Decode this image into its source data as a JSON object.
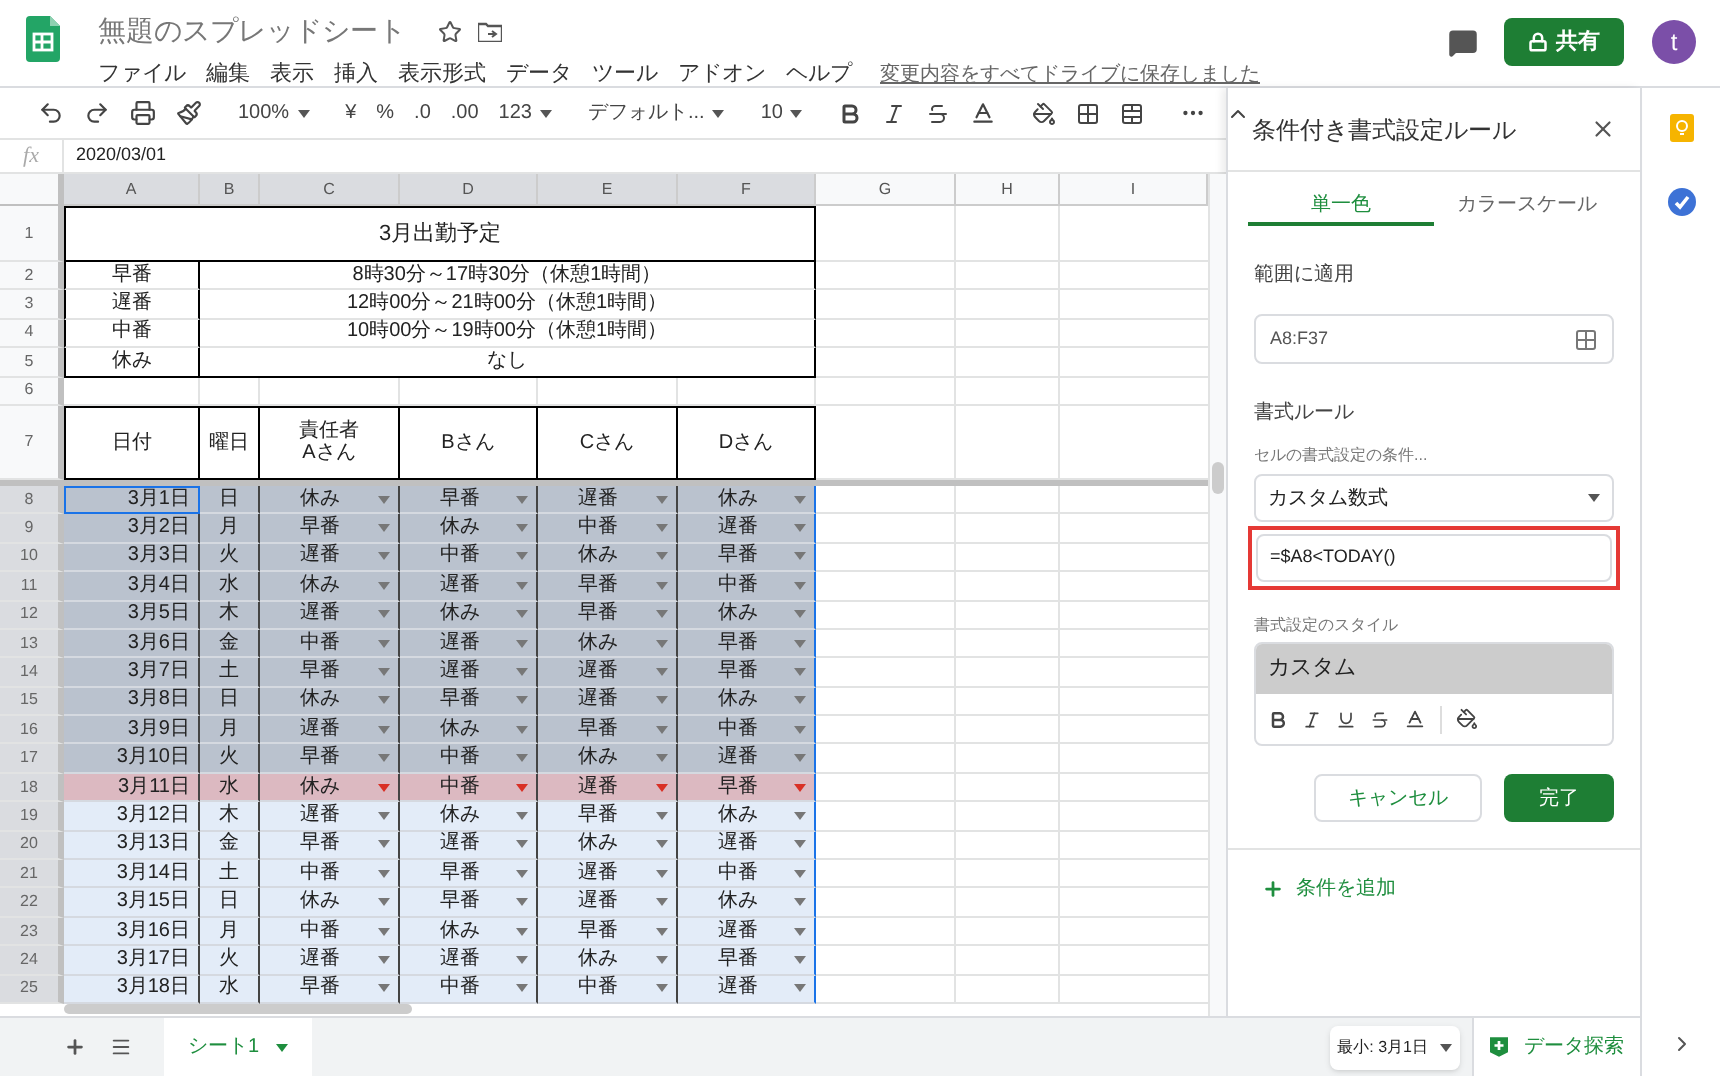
{
  "header": {
    "title": "無題のスプレッドシート",
    "menus": [
      "ファイル",
      "編集",
      "表示",
      "挿入",
      "表示形式",
      "データ",
      "ツール",
      "アドオン",
      "ヘルプ"
    ],
    "save_status": "変更内容をすべてドライブに保存しました",
    "share_button": "共有",
    "avatar_letter": "t"
  },
  "toolbar": {
    "zoom": "100%",
    "currency": "¥",
    "percent": "%",
    "decimal_decrease": ".0",
    "decimal_increase": ".00",
    "number_format": "123",
    "font": "デフォルト...",
    "font_size": "10"
  },
  "formula_bar": {
    "fx": "fx",
    "value": "2020/03/01"
  },
  "sheet": {
    "columns": [
      {
        "label": "A",
        "selected": true
      },
      {
        "label": "B",
        "selected": true
      },
      {
        "label": "C",
        "selected": true
      },
      {
        "label": "D",
        "selected": true
      },
      {
        "label": "E",
        "selected": true
      },
      {
        "label": "F",
        "selected": true
      },
      {
        "label": "G",
        "selected": false
      },
      {
        "label": "H",
        "selected": false
      },
      {
        "label": "I",
        "selected": false
      }
    ],
    "title_row": {
      "num": "1",
      "text": "3月出勤予定"
    },
    "shift_rows": [
      {
        "num": "2",
        "name": "早番",
        "hours": "8時30分～17時30分（休憩1時間）"
      },
      {
        "num": "3",
        "name": "遅番",
        "hours": "12時00分～21時00分（休憩1時間）"
      },
      {
        "num": "4",
        "name": "中番",
        "hours": "10時00分～19時00分（休憩1時間）"
      },
      {
        "num": "5",
        "name": "休み",
        "hours": "なし"
      }
    ],
    "blank_row": {
      "num": "6"
    },
    "header_row": {
      "num": "7",
      "cells": [
        [
          "日付"
        ],
        [
          "曜日"
        ],
        [
          "責任者",
          "Aさん"
        ],
        [
          "Bさん"
        ],
        [
          "Cさん"
        ],
        [
          "Dさん"
        ]
      ]
    },
    "rows": [
      {
        "num": "8",
        "date": "3月1日",
        "weekday": "日",
        "shifts": [
          "休み",
          "早番",
          "遅番",
          "休み"
        ],
        "kind": "past",
        "active": true
      },
      {
        "num": "9",
        "date": "3月2日",
        "weekday": "月",
        "shifts": [
          "早番",
          "休み",
          "中番",
          "遅番"
        ],
        "kind": "past",
        "active": false
      },
      {
        "num": "10",
        "date": "3月3日",
        "weekday": "火",
        "shifts": [
          "遅番",
          "中番",
          "休み",
          "早番"
        ],
        "kind": "past",
        "active": false
      },
      {
        "num": "11",
        "date": "3月4日",
        "weekday": "水",
        "shifts": [
          "休み",
          "遅番",
          "早番",
          "中番"
        ],
        "kind": "past",
        "active": false
      },
      {
        "num": "12",
        "date": "3月5日",
        "weekday": "木",
        "shifts": [
          "遅番",
          "休み",
          "早番",
          "休み"
        ],
        "kind": "past",
        "active": false
      },
      {
        "num": "13",
        "date": "3月6日",
        "weekday": "金",
        "shifts": [
          "中番",
          "遅番",
          "休み",
          "早番"
        ],
        "kind": "past",
        "active": false
      },
      {
        "num": "14",
        "date": "3月7日",
        "weekday": "土",
        "shifts": [
          "早番",
          "遅番",
          "遅番",
          "早番"
        ],
        "kind": "past",
        "active": false
      },
      {
        "num": "15",
        "date": "3月8日",
        "weekday": "日",
        "shifts": [
          "休み",
          "早番",
          "遅番",
          "休み"
        ],
        "kind": "past",
        "active": false
      },
      {
        "num": "16",
        "date": "3月9日",
        "weekday": "月",
        "shifts": [
          "遅番",
          "休み",
          "早番",
          "中番"
        ],
        "kind": "past",
        "active": false
      },
      {
        "num": "17",
        "date": "3月10日",
        "weekday": "火",
        "shifts": [
          "早番",
          "中番",
          "休み",
          "遅番"
        ],
        "kind": "past",
        "active": false
      },
      {
        "num": "18",
        "date": "3月11日",
        "weekday": "水",
        "shifts": [
          "休み",
          "中番",
          "遅番",
          "早番"
        ],
        "kind": "today",
        "active": false
      },
      {
        "num": "19",
        "date": "3月12日",
        "weekday": "木",
        "shifts": [
          "遅番",
          "休み",
          "早番",
          "休み"
        ],
        "kind": "future",
        "active": false
      },
      {
        "num": "20",
        "date": "3月13日",
        "weekday": "金",
        "shifts": [
          "早番",
          "遅番",
          "休み",
          "遅番"
        ],
        "kind": "future",
        "active": false
      },
      {
        "num": "21",
        "date": "3月14日",
        "weekday": "土",
        "shifts": [
          "中番",
          "早番",
          "遅番",
          "中番"
        ],
        "kind": "future",
        "active": false
      },
      {
        "num": "22",
        "date": "3月15日",
        "weekday": "日",
        "shifts": [
          "休み",
          "早番",
          "遅番",
          "休み"
        ],
        "kind": "future",
        "active": false
      },
      {
        "num": "23",
        "date": "3月16日",
        "weekday": "月",
        "shifts": [
          "中番",
          "休み",
          "早番",
          "遅番"
        ],
        "kind": "future",
        "active": false
      },
      {
        "num": "24",
        "date": "3月17日",
        "weekday": "火",
        "shifts": [
          "遅番",
          "遅番",
          "休み",
          "早番"
        ],
        "kind": "future",
        "active": false
      },
      {
        "num": "25",
        "date": "3月18日",
        "weekday": "水",
        "shifts": [
          "早番",
          "中番",
          "中番",
          "遅番"
        ],
        "kind": "future",
        "active": false
      }
    ]
  },
  "bottom_bar": {
    "sheet_tabs": [
      {
        "label": "シート1",
        "selected": true
      }
    ],
    "summary": "最小: 3月1日",
    "explore": "データ探索"
  },
  "panel": {
    "title": "条件付き書式設定ルール",
    "tabs": [
      {
        "label": "単一色",
        "selected": true
      },
      {
        "label": "カラースケール",
        "selected": false
      }
    ],
    "range_label": "範囲に適用",
    "range_value": "A8:F37",
    "rules_label": "書式ルール",
    "condition_label": "セルの書式設定の条件...",
    "condition_value": "カスタム数式",
    "formula_value": "=$A8<TODAY()",
    "formula_highlighted": true,
    "style_label": "書式設定のスタイル",
    "style_preview": "カスタム",
    "cancel_button": "キャンセル",
    "done_button": "完了",
    "add_rule": "条件を追加"
  }
}
